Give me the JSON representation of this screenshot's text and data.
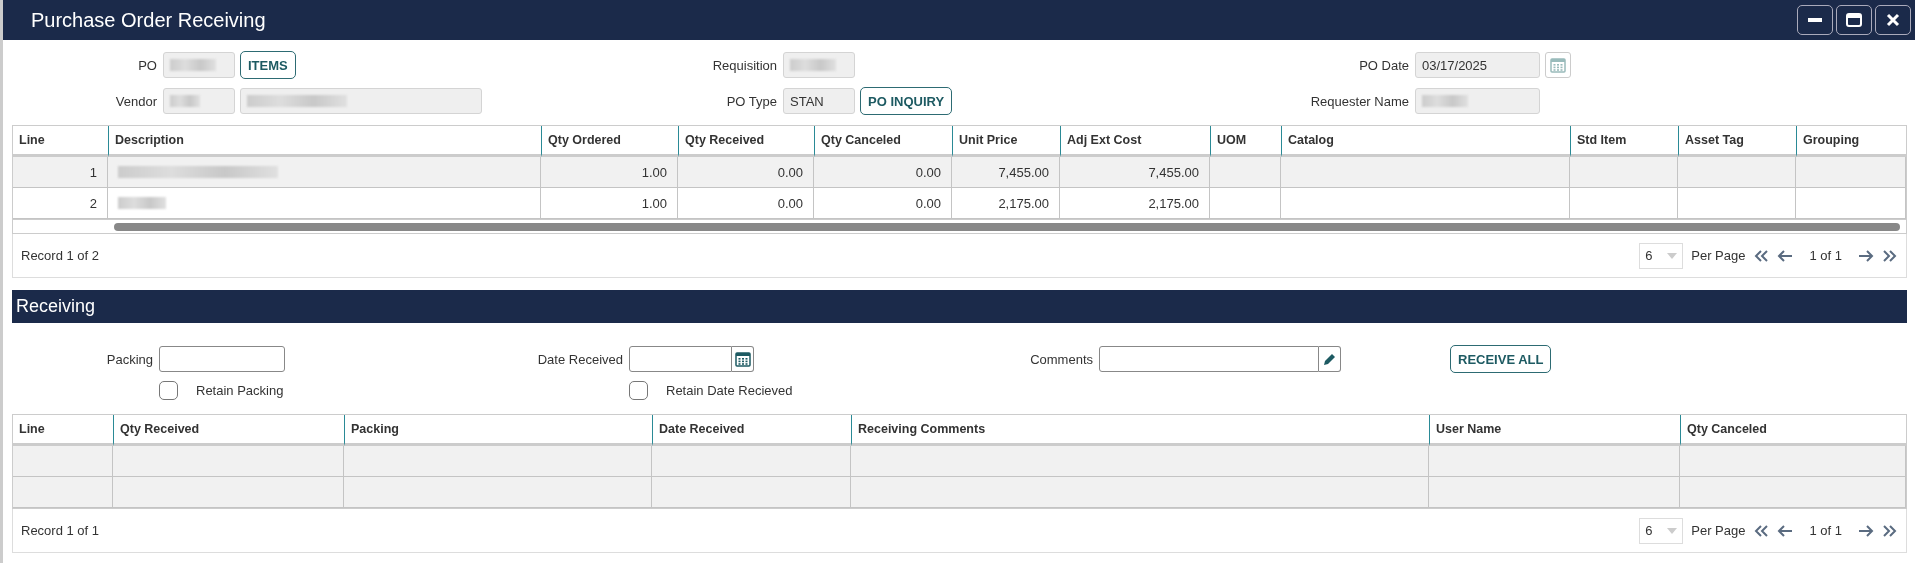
{
  "window": {
    "title": "Purchase Order Receiving"
  },
  "header_fields": [
    {
      "label": "PO",
      "kind": "redacted",
      "button": "ITEMS"
    },
    {
      "label": "Requisition",
      "kind": "redacted"
    },
    {
      "label": "PO Date",
      "kind": "date",
      "value": "03/17/2025"
    },
    {
      "label": "Vendor",
      "kind": "redacted_pair"
    },
    {
      "label": "PO Type",
      "kind": "text",
      "value": "STAN",
      "button": "PO INQUIRY"
    },
    {
      "label": "Requester Name",
      "kind": "redacted"
    }
  ],
  "items_table": {
    "columns": [
      "Line",
      "Description",
      "Qty Ordered",
      "Qty Received",
      "Qty Canceled",
      "Unit Price",
      "Adj Ext Cost",
      "UOM",
      "Catalog",
      "Std Item",
      "Asset Tag",
      "Grouping"
    ],
    "rows": [
      {
        "selected": true,
        "cells": [
          "1",
          null,
          "1.00",
          "0.00",
          "0.00",
          "7,455.00",
          "7,455.00",
          null,
          null,
          null,
          null,
          null
        ]
      },
      {
        "selected": false,
        "cells": [
          "2",
          null,
          "1.00",
          "0.00",
          "0.00",
          "2,175.00",
          "2,175.00",
          null,
          null,
          null,
          null,
          null
        ]
      }
    ],
    "record": "Record 1 of 2",
    "per_page_value": "6",
    "per_page": "Per Page",
    "page": "1 of 1"
  },
  "receiving": {
    "title": "Receiving",
    "packing": {
      "label": "Packing"
    },
    "retain_packing": {
      "label": "Retain Packing",
      "checked": false
    },
    "date_received": {
      "label": "Date Received"
    },
    "retain_date": {
      "label": "Retain Date Recieved",
      "checked": false
    },
    "comments": {
      "label": "Comments"
    },
    "receive_all": "RECEIVE ALL"
  },
  "receiving_table": {
    "columns": [
      "Line",
      "Qty Received",
      "Packing",
      "Date Received",
      "Receiving Comments",
      "User Name",
      "Qty Canceled"
    ],
    "record": "Record 1 of 1",
    "per_page_value": "6",
    "per_page": "Per Page",
    "page": "1 of 1"
  }
}
